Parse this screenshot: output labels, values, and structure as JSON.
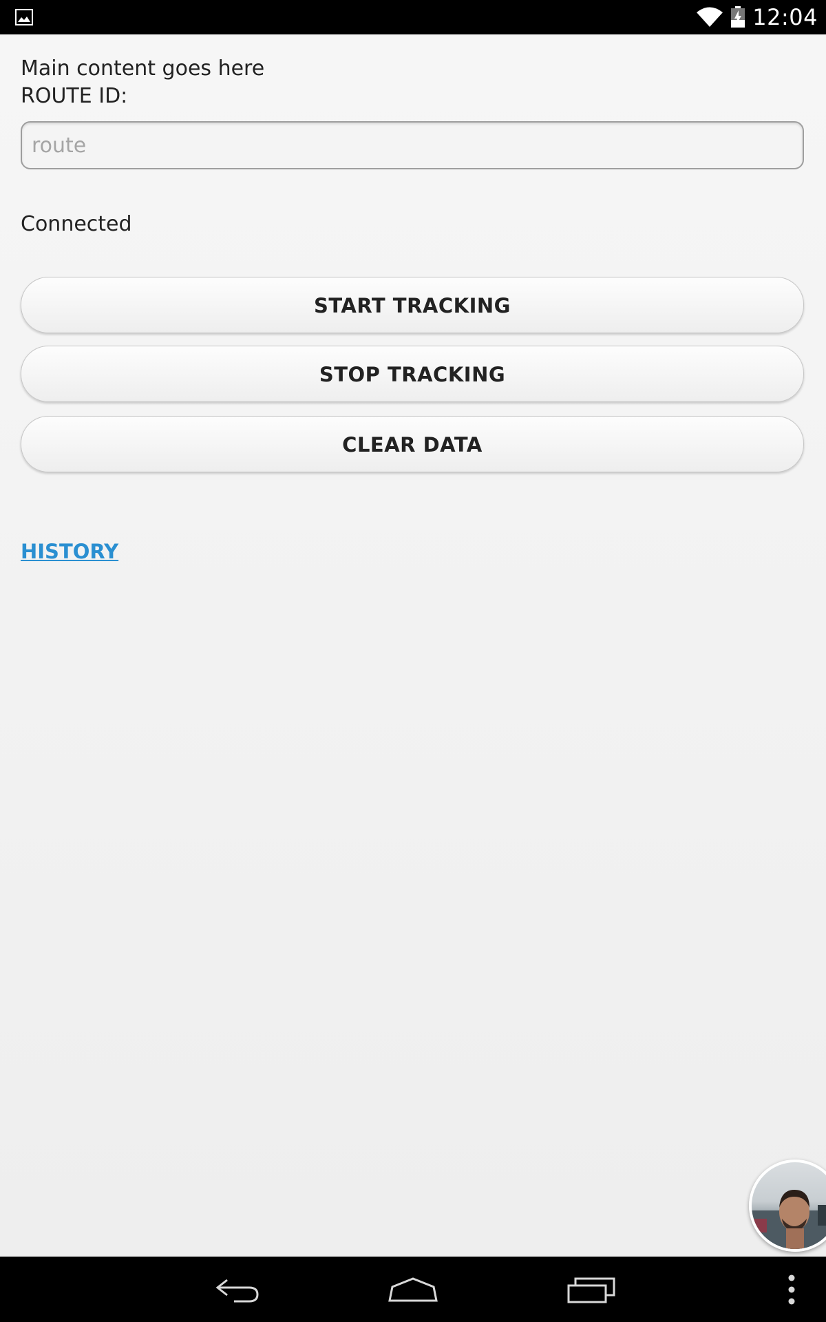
{
  "status_bar": {
    "time": "12:04",
    "icons": [
      "image-notification-icon",
      "wifi-icon",
      "battery-charging-icon"
    ]
  },
  "main": {
    "content_label": "Main content goes here",
    "route_label": "ROUTE ID:",
    "route_input": {
      "value": "",
      "placeholder": "route"
    },
    "connection_status": "Connected",
    "buttons": {
      "start": "START TRACKING",
      "stop": "STOP TRACKING",
      "clear": "CLEAR DATA"
    },
    "history_link": "HISTORY"
  },
  "chat_head": {
    "icon": "avatar-chat-head"
  },
  "nav_bar": {
    "icons": [
      "back-icon",
      "home-icon",
      "recents-icon",
      "overflow-menu-icon"
    ]
  },
  "colors": {
    "link": "#2a8fd1",
    "background": "#f1f1f1",
    "bars": "#000000"
  }
}
